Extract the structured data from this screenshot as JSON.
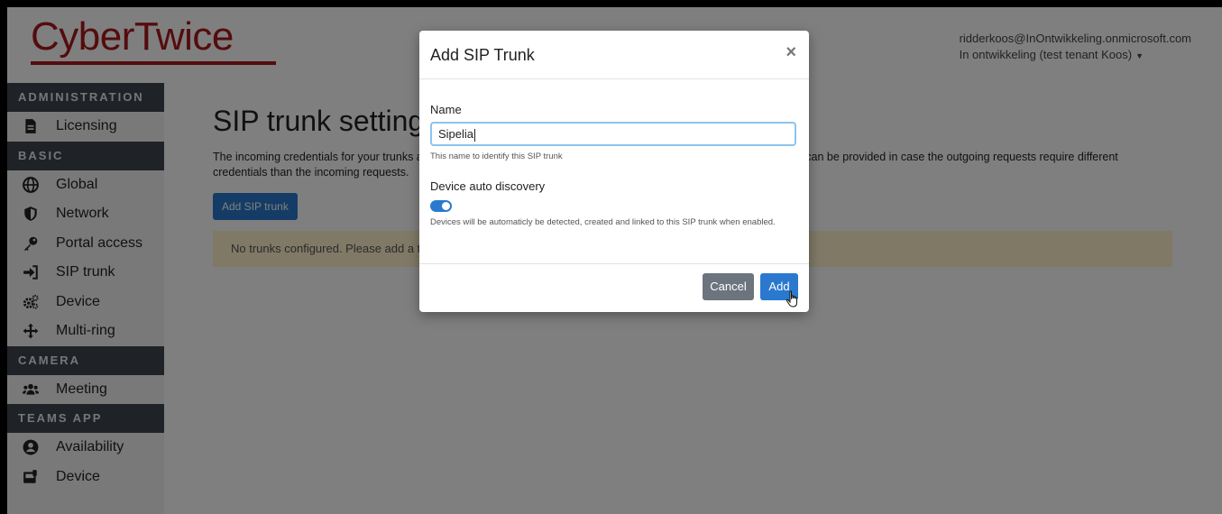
{
  "header": {
    "logo_text": "CyberTwice",
    "user_email": "ridderkoos@InOntwikkeling.onmicrosoft.com",
    "tenant": "In ontwikkeling (test tenant Koos)"
  },
  "sidebar": {
    "sections": [
      {
        "title": "Administration",
        "items": [
          {
            "label": "Licensing",
            "icon": "file-icon"
          }
        ]
      },
      {
        "title": "Basic",
        "items": [
          {
            "label": "Global",
            "icon": "globe-icon"
          },
          {
            "label": "Network",
            "icon": "shield-icon"
          },
          {
            "label": "Portal access",
            "icon": "key-icon"
          },
          {
            "label": "SIP trunk",
            "icon": "sign-in-icon"
          },
          {
            "label": "Device",
            "icon": "gears-icon"
          },
          {
            "label": "Multi-ring",
            "icon": "arrows-icon"
          }
        ]
      },
      {
        "title": "Camera",
        "items": [
          {
            "label": "Meeting",
            "icon": "users-icon"
          }
        ]
      },
      {
        "title": "Teams App",
        "items": [
          {
            "label": "Availability",
            "icon": "user-circle-icon"
          },
          {
            "label": "Device",
            "icon": "phone-device-icon"
          }
        ]
      }
    ]
  },
  "main": {
    "title": "SIP trunk settings",
    "description_left": "The incoming credentials for your trunks a",
    "description_right": "ls can be provided in case the outgoing requests require different",
    "description_line2": "credentials than the incoming requests.",
    "add_button": "Add SIP trunk",
    "alert": "No trunks configured. Please add a trun"
  },
  "modal": {
    "title": "Add SIP Trunk",
    "close": "×",
    "name_label": "Name",
    "name_value": "Sipelia",
    "name_help": "This name to identify this SIP trunk",
    "discovery_label": "Device auto discovery",
    "discovery_enabled": true,
    "discovery_help": "Devices will be automaticly be detected, created and linked to this SIP trunk when enabled.",
    "cancel": "Cancel",
    "add": "Add"
  },
  "colors": {
    "brand": "#a8181d",
    "primary": "#2b79cf",
    "sidebar_header": "#3f474f",
    "alert_bg": "#fff3cd"
  }
}
